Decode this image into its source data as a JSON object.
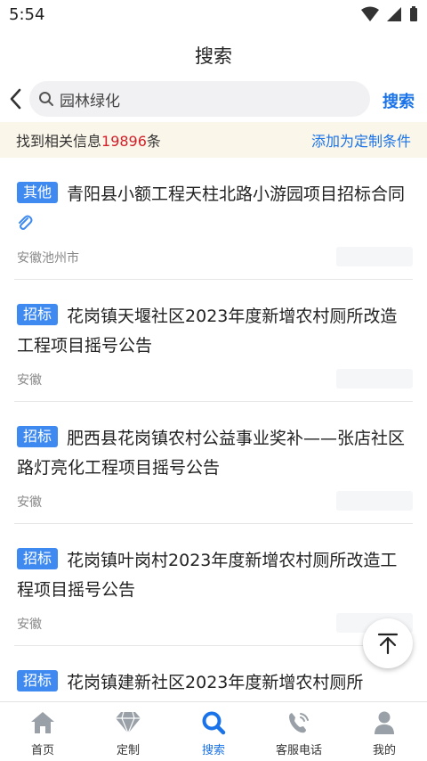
{
  "status": {
    "time": "5:54"
  },
  "header": {
    "title": "搜索"
  },
  "search": {
    "value": "园林绿化",
    "button": "搜索"
  },
  "results_bar": {
    "prefix": "找到相关信息",
    "count": "19896",
    "suffix": "条",
    "custom_link": "添加为定制条件"
  },
  "items": [
    {
      "tag": "其他",
      "title": "青阳县小额工程天柱北路小游园项目招标合同",
      "region": "安徽池州市",
      "has_attachment": true
    },
    {
      "tag": "招标",
      "title": "花岗镇天堰社区2023年度新增农村厕所改造工程项目摇号公告",
      "region": "安徽"
    },
    {
      "tag": "招标",
      "title": "肥西县花岗镇农村公益事业奖补——张店社区路灯亮化工程项目摇号公告",
      "region": "安徽"
    },
    {
      "tag": "招标",
      "title": "花岗镇叶岗村2023年度新增农村厕所改造工程项目摇号公告",
      "region": "安徽"
    },
    {
      "tag": "招标",
      "title": "花岗镇建新社区2023年度新增农村厕所",
      "region": ""
    }
  ],
  "nav": {
    "home": "首页",
    "custom": "定制",
    "search": "搜索",
    "phone": "客服电话",
    "mine": "我的"
  },
  "colors": {
    "accent": "#1a73e8",
    "tag": "#3f8af0",
    "count": "#d0202a",
    "info_bg": "#fbf6ea"
  }
}
